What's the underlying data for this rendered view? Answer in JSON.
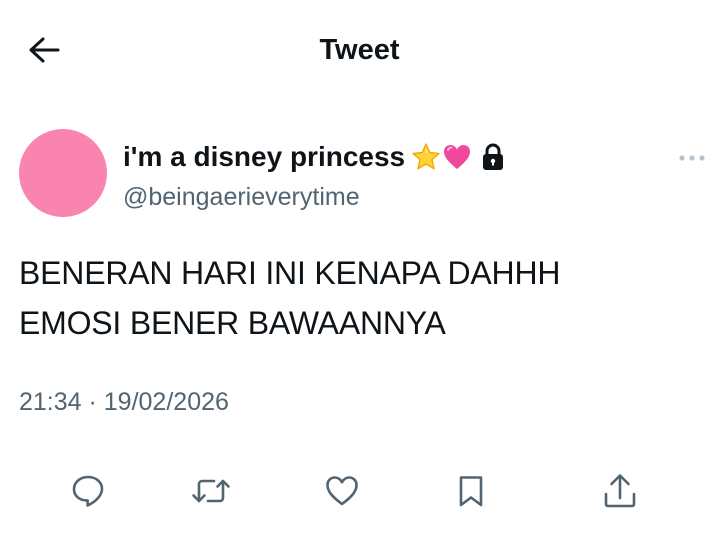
{
  "header": {
    "title": "Tweet",
    "back_icon": "arrow-left-icon"
  },
  "author": {
    "display_name": "i'm a disney princess",
    "emojis": [
      "star-emoji",
      "pink-heart-emoji"
    ],
    "protected_icon": "lock-icon",
    "handle": "@beingaerieverytime",
    "avatar_color": "#f984b0"
  },
  "tweet": {
    "lines": [
      "BENERAN HARI INI KENAPA DAHHH",
      "EMOSI BENER BAWAANNYA"
    ],
    "timestamp": "21:34 · 19/02/2026"
  },
  "actions": [
    "reply-icon",
    "retweet-icon",
    "like-icon",
    "bookmark-icon",
    "share-icon"
  ],
  "colors": {
    "text": "#0f1419",
    "secondary": "#536471",
    "icon": "#536471"
  }
}
